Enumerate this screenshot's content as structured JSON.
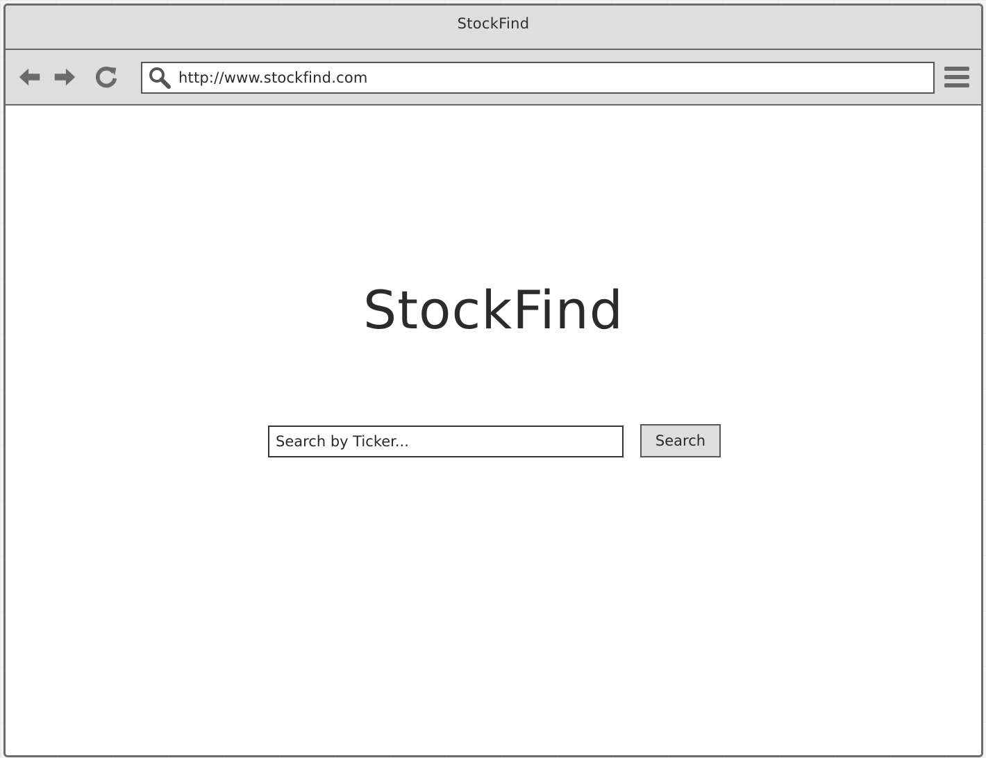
{
  "window": {
    "title": "StockFind"
  },
  "toolbar": {
    "url": "http://www.stockfind.com",
    "icons": {
      "back": "back-arrow-icon",
      "forward": "forward-arrow-icon",
      "reload": "reload-icon",
      "address_search": "search-icon",
      "menu": "hamburger-menu-icon"
    }
  },
  "main": {
    "logo_title": "StockFind",
    "search": {
      "placeholder": "Search by Ticker...",
      "value": "",
      "button_label": "Search"
    }
  },
  "colors": {
    "chrome_bg": "#dedede",
    "border": "#6b6b6b",
    "icon": "#6b6b6b",
    "text": "#2b2b2b",
    "page_bg": "#ffffff"
  }
}
